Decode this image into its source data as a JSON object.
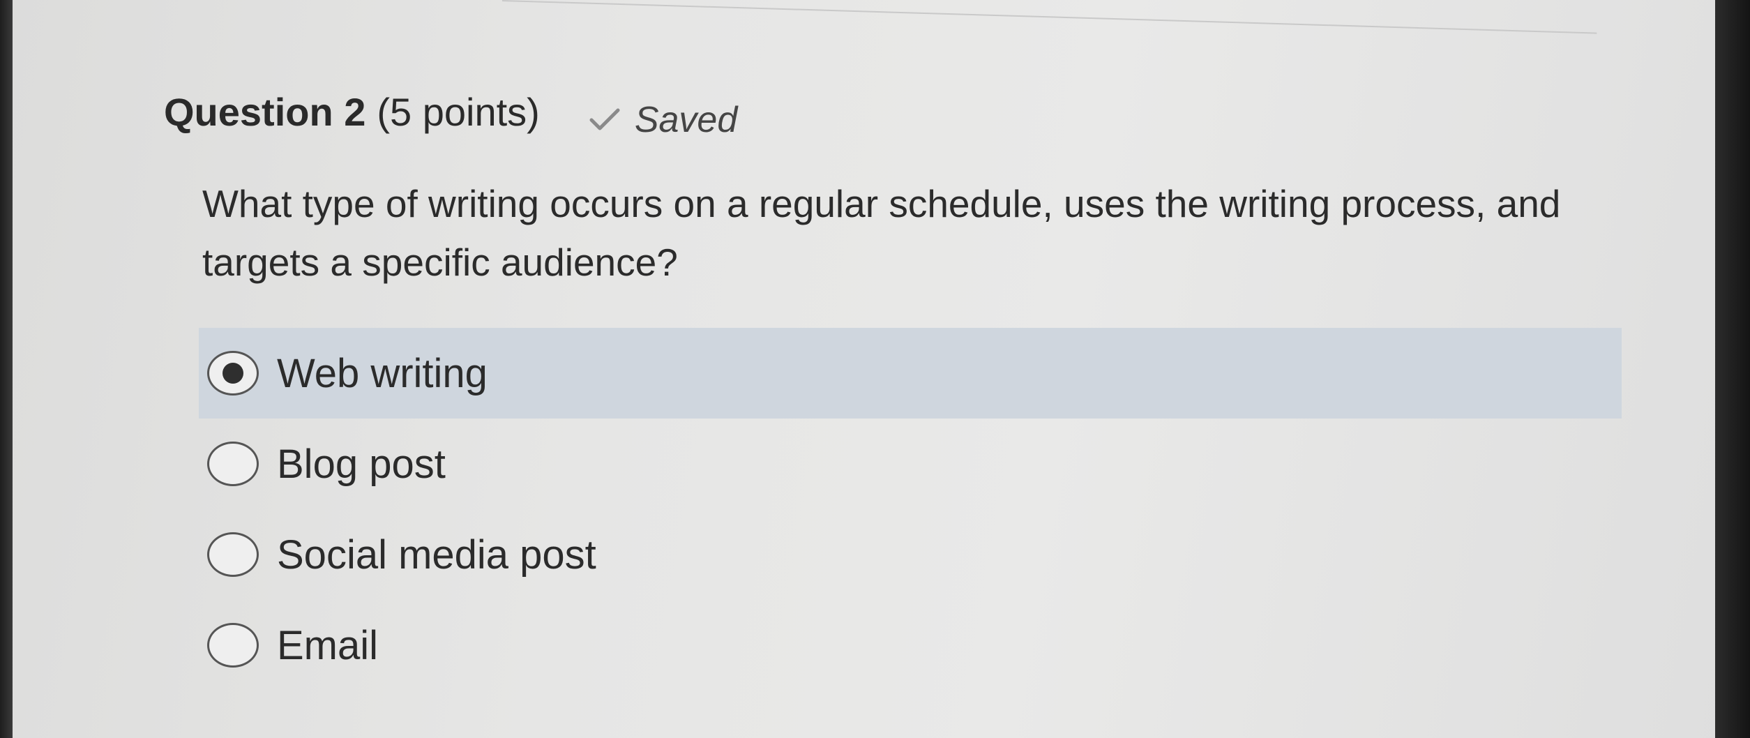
{
  "question": {
    "title": "Question 2",
    "points": "(5 points)",
    "status": {
      "icon": "checkmark-icon",
      "label": "Saved"
    },
    "text": "What type of writing occurs on a regular schedule, uses the writing process, and targets a specific audience?",
    "options": [
      {
        "label": "Web writing",
        "selected": true
      },
      {
        "label": "Blog post",
        "selected": false
      },
      {
        "label": "Social media post",
        "selected": false
      },
      {
        "label": "Email",
        "selected": false
      }
    ]
  },
  "colors": {
    "selected_row": "#cfd6de",
    "page_background": "#e6e6e5",
    "text": "#2b2b2b"
  }
}
